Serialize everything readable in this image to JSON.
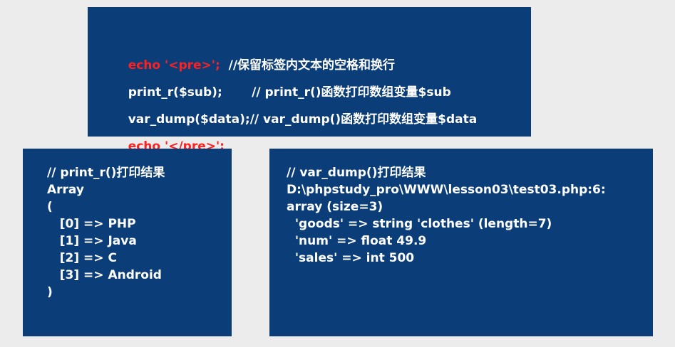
{
  "top_panel": {
    "lines": [
      {
        "code": "echo '<pre>';",
        "comment": "  //保留标签内文本的空格和换行"
      },
      {
        "code": "print_r($sub);",
        "comment": "       // print_r()函数打印数组变量$sub"
      },
      {
        "code": "var_dump($data);",
        "comment": "// var_dump()函数打印数组变量$data"
      },
      {
        "code": "echo '</pre>';",
        "comment": ""
      }
    ]
  },
  "left_panel": {
    "lines": [
      "// print_r()打印结果",
      "Array",
      "(",
      "   [0] => PHP",
      "   [1] => Java",
      "   [2] => C",
      "   [3] => Android",
      ")"
    ]
  },
  "right_panel": {
    "lines": [
      "// var_dump()打印结果",
      "D:\\phpstudy_pro\\WWW\\lesson03\\test03.php:6:",
      "array (size=3)",
      "  'goods' => string 'clothes' (length=7)",
      "  'num' => float 49.9",
      "  'sales' => int 500"
    ]
  },
  "colors": {
    "panel_background": "#0b3d78",
    "page_background": "#ececec",
    "highlight": "#ff2020",
    "text": "#ffffff"
  }
}
